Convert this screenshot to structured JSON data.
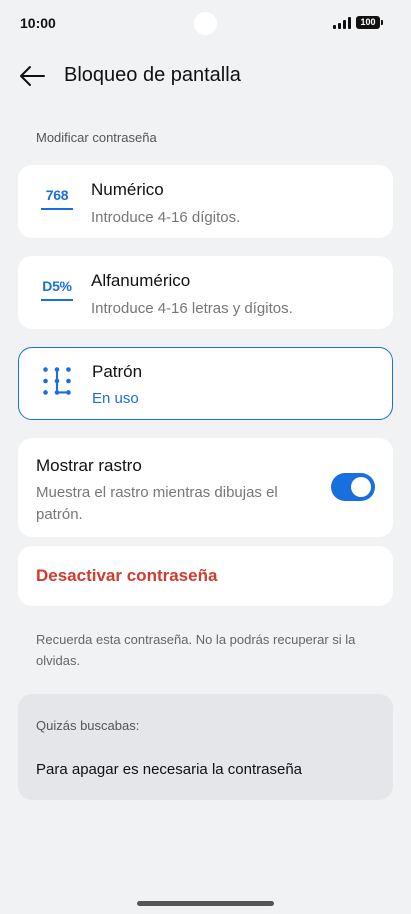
{
  "status_bar": {
    "time": "10:00",
    "battery": "100",
    "icons": [
      "camera-cutout",
      "signal-icon",
      "battery-icon"
    ]
  },
  "header": {
    "title": "Bloqueo de pantalla",
    "back_icon": "arrow-left-icon"
  },
  "section_label": "Modificar contraseña",
  "options": [
    {
      "icon_text": "768",
      "title": "Numérico",
      "subtitle": "Introduce 4-16 dígitos."
    },
    {
      "icon_text": "D5%",
      "title": "Alfanumérico",
      "subtitle": "Introduce 4-16 letras y dígitos."
    },
    {
      "icon": "pattern-icon",
      "title": "Patrón",
      "subtitle": "En uso",
      "selected": true
    }
  ],
  "trail": {
    "title": "Mostrar rastro",
    "subtitle": "Muestra el rastro mientras dibujas el patrón.",
    "enabled": true
  },
  "disable_label": "Desactivar contraseña",
  "note": "Recuerda esta contraseña. No la podrás recuperar si la olvidas.",
  "suggestions": {
    "label": "Quizás buscabas:",
    "item": "Para apagar es necesaria la contraseña"
  },
  "colors": {
    "accent": "#1a6fe0",
    "danger": "#d23b30",
    "background": "#f1f2f4",
    "card": "#ffffff"
  }
}
